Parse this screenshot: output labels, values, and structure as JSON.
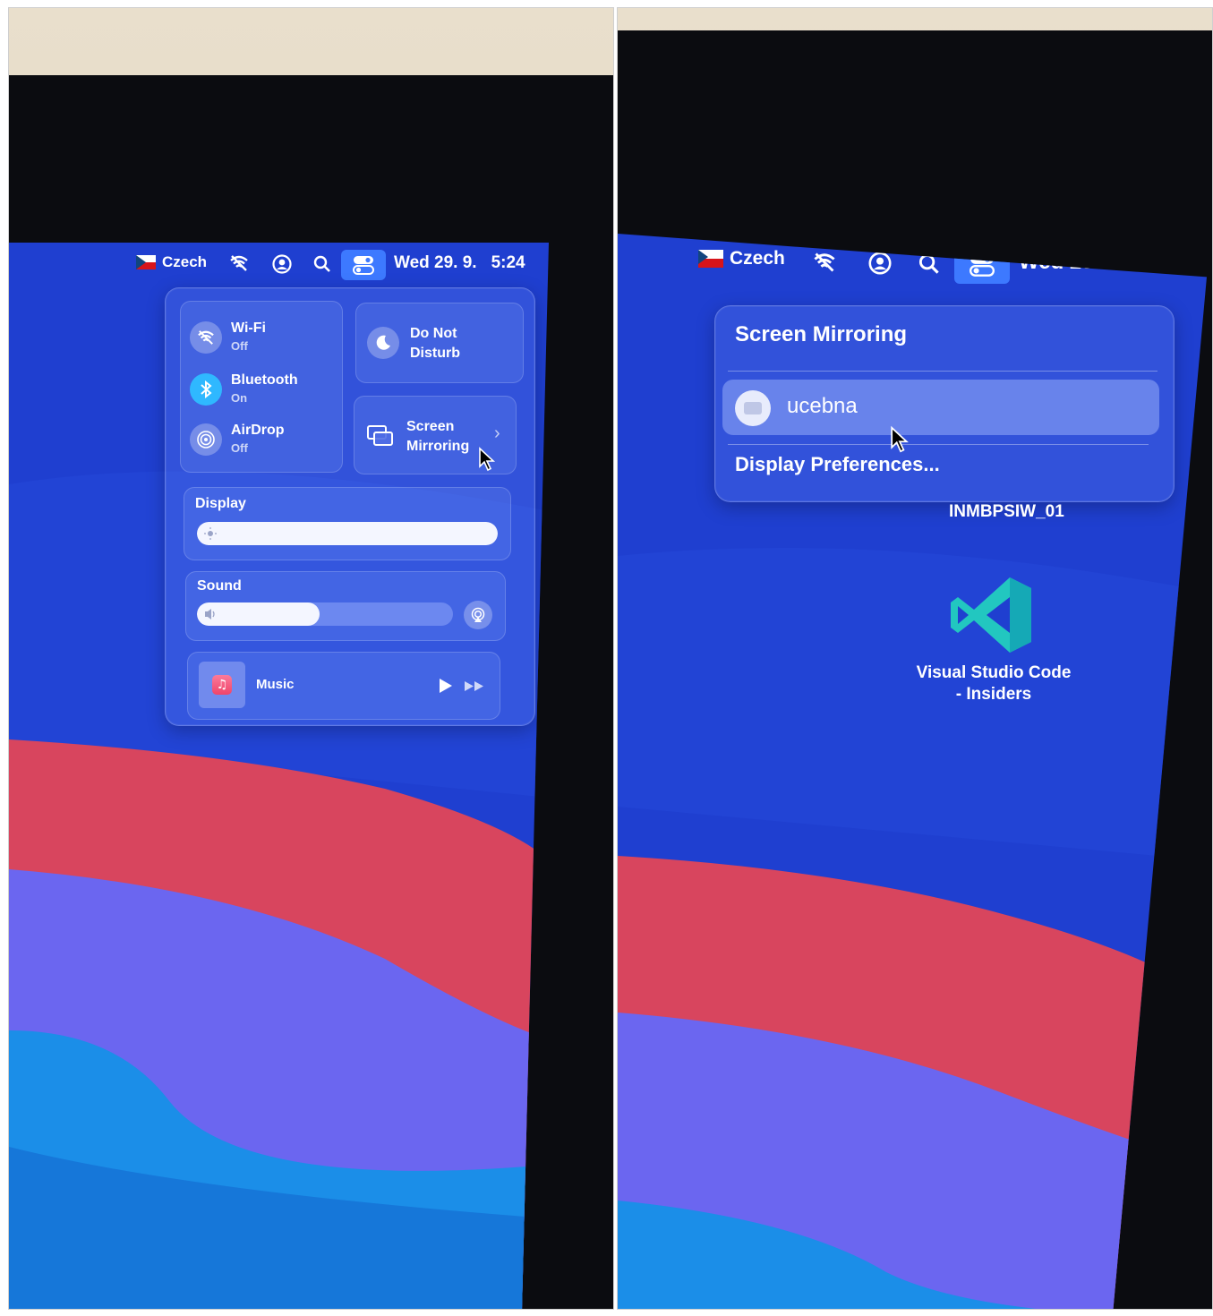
{
  "menubar": {
    "input_source": "Czech",
    "date": "Wed 29. 9.",
    "time": "5:24"
  },
  "control_center": {
    "wifi": {
      "label": "Wi-Fi",
      "status": "Off"
    },
    "bluetooth": {
      "label": "Bluetooth",
      "status": "On"
    },
    "airdrop": {
      "label": "AirDrop",
      "status": "Off"
    },
    "do_not_disturb": {
      "line1": "Do Not",
      "line2": "Disturb"
    },
    "screen_mirroring": {
      "line1": "Screen",
      "line2": "Mirroring"
    },
    "display": {
      "label": "Display",
      "level": 1.0
    },
    "sound": {
      "label": "Sound",
      "level": 0.48
    },
    "now_playing": {
      "app": "Music"
    }
  },
  "mirroring_menu": {
    "title": "Screen Mirroring",
    "device": "ucebna",
    "footer": "Display Preferences..."
  },
  "desktop": {
    "hard_drive_label": "INMBPSIW_01",
    "app_icon_line1": "Visual Studio Code",
    "app_icon_line2": "- Insiders"
  },
  "colors": {
    "desktop_blue": "#1f3fd0",
    "wave_red": "#d8455e",
    "wave_violet": "#6b66f0",
    "wave_cyan": "#1b8ee8",
    "accent": "#3d79ff"
  }
}
